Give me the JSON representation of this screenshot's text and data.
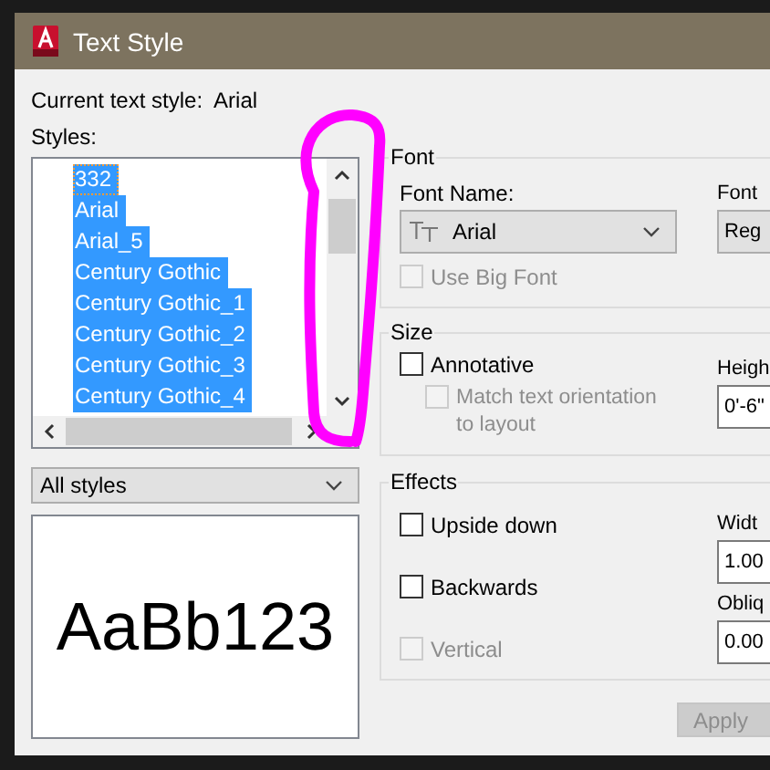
{
  "window": {
    "title": "Text Style"
  },
  "current_style": {
    "label": "Current text style:",
    "value": "Arial"
  },
  "styles": {
    "label": "Styles:",
    "items": [
      {
        "name": "332",
        "selected": true,
        "focused": true
      },
      {
        "name": "Arial",
        "selected": true,
        "focused": false
      },
      {
        "name": "Arial_5",
        "selected": true,
        "focused": false
      },
      {
        "name": "Century Gothic",
        "selected": true,
        "focused": false
      },
      {
        "name": "Century Gothic_1",
        "selected": true,
        "focused": false
      },
      {
        "name": "Century Gothic_2",
        "selected": true,
        "focused": false
      },
      {
        "name": "Century Gothic_3",
        "selected": true,
        "focused": false
      },
      {
        "name": "Century Gothic_4",
        "selected": true,
        "focused": false
      }
    ]
  },
  "filter": {
    "value": "All styles"
  },
  "preview": {
    "text": "AaBb123"
  },
  "font": {
    "legend": "Font",
    "font_name_label": "Font Name:",
    "font_name": "Arial",
    "style_label": "Font",
    "style_value": "Reg",
    "big_font": {
      "label": "Use Big Font",
      "checked": false,
      "disabled": true
    }
  },
  "size": {
    "legend": "Size",
    "annotative": {
      "label": "Annotative",
      "checked": false,
      "disabled": false
    },
    "match": {
      "label": "Match text orientation to layout",
      "checked": false,
      "disabled": true
    },
    "height_label": "Heigh",
    "height_value": "0'-6\""
  },
  "effects": {
    "legend": "Effects",
    "checks": [
      {
        "label": "Upside down",
        "checked": false,
        "disabled": false
      },
      {
        "label": "Backwards",
        "checked": false,
        "disabled": false
      },
      {
        "label": "Vertical",
        "checked": false,
        "disabled": true
      }
    ],
    "width_label": "Widt",
    "width_value": "1.00",
    "oblique_label": "Obliq",
    "oblique_value": "0.00"
  },
  "buttons": [
    {
      "label": "Apply",
      "disabled": true
    }
  ]
}
